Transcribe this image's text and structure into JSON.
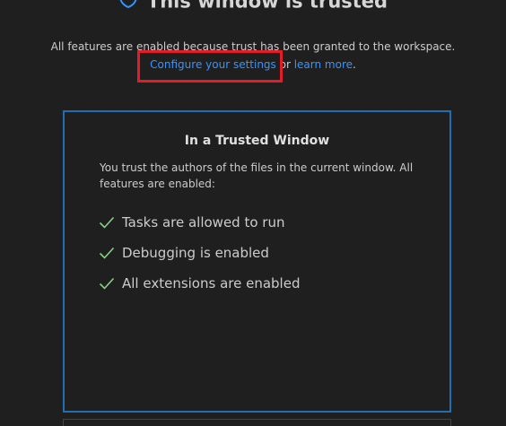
{
  "header": {
    "title": "This window is trusted",
    "shield_icon": "shield-icon"
  },
  "subtitle": {
    "text": "All features are enabled because trust has been granted to the workspace.",
    "configure_link": "Configure your settings",
    "connector": " or ",
    "learn_more_link": "learn more",
    "end": "."
  },
  "trusted_card": {
    "title": "In a Trusted Window",
    "description": "You trust the authors of the files in the current window. All features are enabled:",
    "features": [
      {
        "label": "Tasks are allowed to run",
        "icon": "check-icon"
      },
      {
        "label": "Debugging is enabled",
        "icon": "check-icon"
      },
      {
        "label": "All extensions are enabled",
        "icon": "check-icon"
      }
    ]
  },
  "colors": {
    "background": "#1f1f1f",
    "link": "#3794ff",
    "card_border": "#1f6fb1",
    "check": "#89d185",
    "highlight": "#e11d2a"
  }
}
